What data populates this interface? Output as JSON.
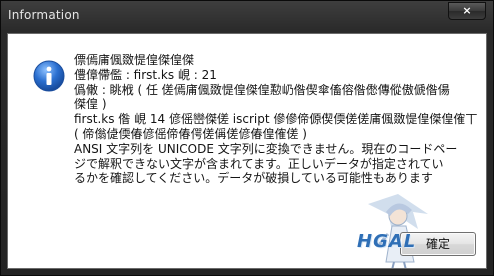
{
  "window": {
    "title": "Information",
    "close_glyph": "×"
  },
  "dialog": {
    "icon": "information-icon",
    "message_lines": [
      "僄傿庯偑敪惿偟傑偟傑",
      "僼傽僀儖 : first.ks   峴 : 21",
      "僞僌 : 眺栰 ( 任 傞傿庯偑敪惿偟傑偟懃屷偺偰傘傗傛偺僽傳傱傲傂偺偒",
      "傑偟 )",
      "first.ks 偺 峴 14 偐傜巒傑傞 iscript 傪傪偙傆偰偄傞傞庯偑敪惿偟傑偟傕丅",
      "( 偙傟偼偄偆偐傜偙偆偔傞偁傞偐偆偟傕傞 )",
      "ANSI 文字列を UNICODE 文字列に変換できません。現在のコードペー",
      "ジで解釈できない文字が含まれてます。正しいデータが指定されてい",
      "るかを確認してください。データが破損している可能性もあります"
    ],
    "ok_button_label": "確定"
  },
  "watermark": {
    "text": "HGAL"
  },
  "colors": {
    "title_bar": "#2a2a2a",
    "title_text": "#e6e6e6",
    "client_background": "#ffffff",
    "info_icon": "#2a6fd0",
    "watermark": "#2f6fb6"
  }
}
